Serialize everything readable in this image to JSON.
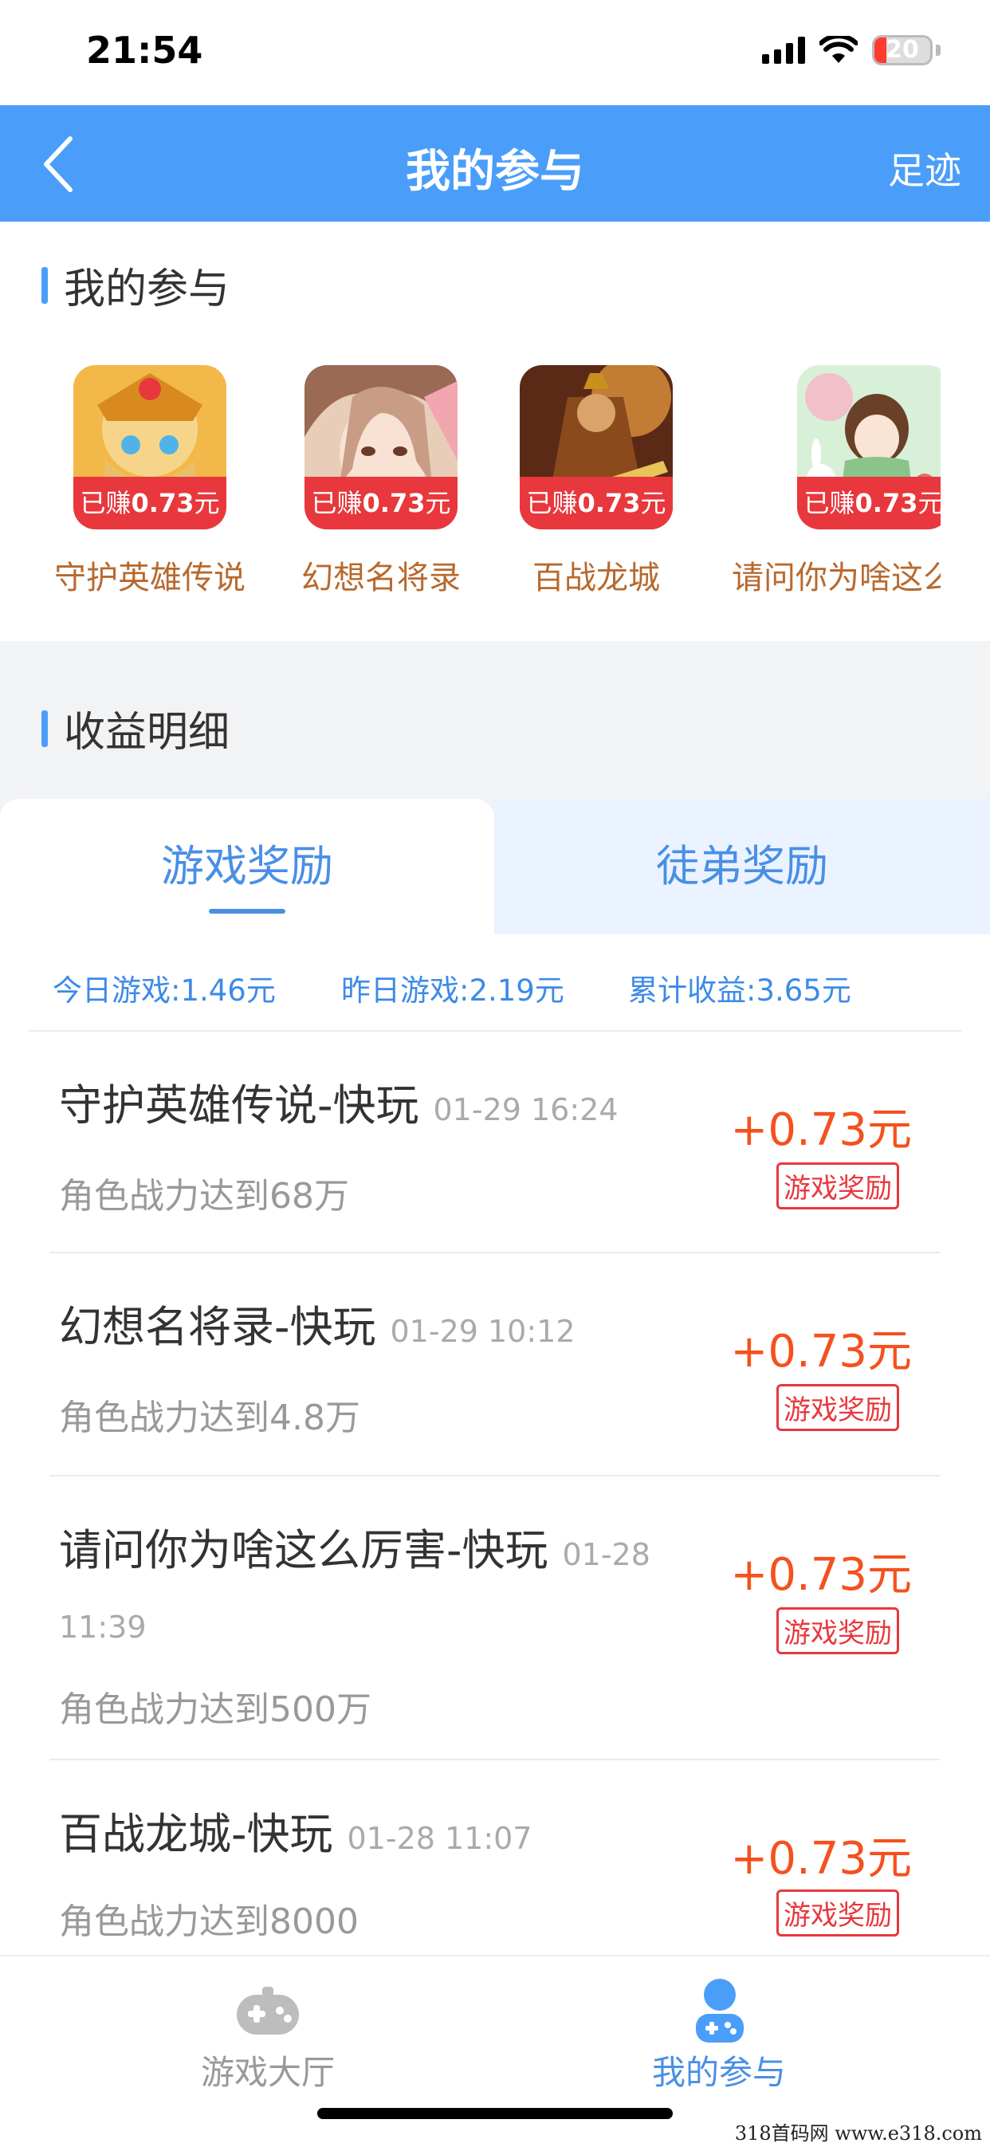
{
  "status_bar": {
    "time": "21:54",
    "battery": "20"
  },
  "nav": {
    "title": "我的参与",
    "right_label": "足迹"
  },
  "participation": {
    "heading": "我的参与",
    "games": [
      {
        "name": "守护英雄传说",
        "earn_prefix": "已赚",
        "earn_amount": "0.73",
        "earn_unit": "元"
      },
      {
        "name": "幻想名将录",
        "earn_prefix": "已赚",
        "earn_amount": "0.73",
        "earn_unit": "元"
      },
      {
        "name": "百战龙城",
        "earn_prefix": "已赚",
        "earn_amount": "0.73",
        "earn_unit": "元"
      },
      {
        "name": "请问你为啥这么",
        "earn_prefix": "已赚",
        "earn_amount": "0.73",
        "earn_unit": "元"
      }
    ]
  },
  "income": {
    "heading": "收益明细",
    "tabs": [
      {
        "label": "游戏奖励"
      },
      {
        "label": "徒弟奖励"
      }
    ],
    "stats": {
      "today": "今日游戏:1.46元",
      "yesterday": "昨日游戏:2.19元",
      "total": "累计收益:3.65元"
    },
    "records": [
      {
        "title": "守护英雄传说-快玩",
        "time": "01-29 16:24",
        "desc": "角色战力达到68万",
        "amount": "+0.73元",
        "tag": "游戏奖励"
      },
      {
        "title": "幻想名将录-快玩",
        "time": "01-29 10:12",
        "desc": "角色战力达到4.8万",
        "amount": "+0.73元",
        "tag": "游戏奖励"
      },
      {
        "title": "请问你为啥这么厉害-快玩",
        "time": "01-28 11:39",
        "desc": "角色战力达到500万",
        "amount": "+0.73元",
        "tag": "游戏奖励"
      },
      {
        "title": "百战龙城-快玩",
        "time": "01-28 11:07",
        "desc": "角色战力达到8000",
        "amount": "+0.73元",
        "tag": "游戏奖励"
      }
    ]
  },
  "tabbar": {
    "items": [
      {
        "label": "游戏大厅",
        "icon": "gamepad-icon",
        "active": false
      },
      {
        "label": "我的参与",
        "icon": "user-gamepad-icon",
        "active": true
      }
    ]
  },
  "watermark": "318首码网  www.e318.com",
  "colors": {
    "primary": "#4a9ef9",
    "accent_orange": "#f4511e",
    "badge_red": "#e8383d",
    "game_name": "#b8692e"
  }
}
